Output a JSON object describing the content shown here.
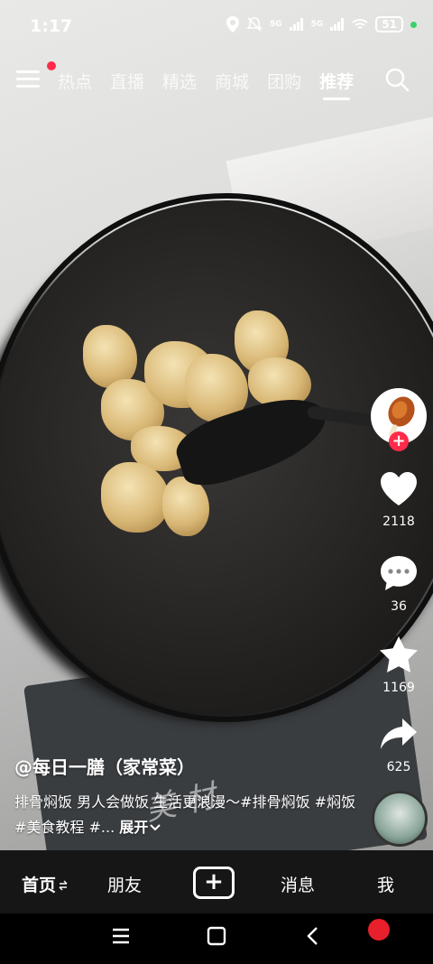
{
  "status_bar": {
    "time": "1:17",
    "signal_1": "5G",
    "signal_2": "5G",
    "battery": "51"
  },
  "top_nav": {
    "tabs": [
      "热点",
      "直播",
      "精选",
      "商城",
      "团购",
      "推荐"
    ],
    "active_tab": "推荐"
  },
  "video": {
    "author": "@每日一膳（家常菜）",
    "description": "排骨焖饭 男人会做饭 生活更浪漫～#排骨焖饭 #焖饭 #美食教程 #...",
    "expand_label": "展开",
    "watermark": "美 材"
  },
  "actions": {
    "likes": "2118",
    "comments": "36",
    "favorites": "1169",
    "shares": "625"
  },
  "bottom_nav": {
    "home": "首页",
    "friends": "朋友",
    "create": "+",
    "messages": "消息",
    "me": "我"
  },
  "colors": {
    "accent": "#ff2b4a",
    "nav_bg": "#161616"
  }
}
